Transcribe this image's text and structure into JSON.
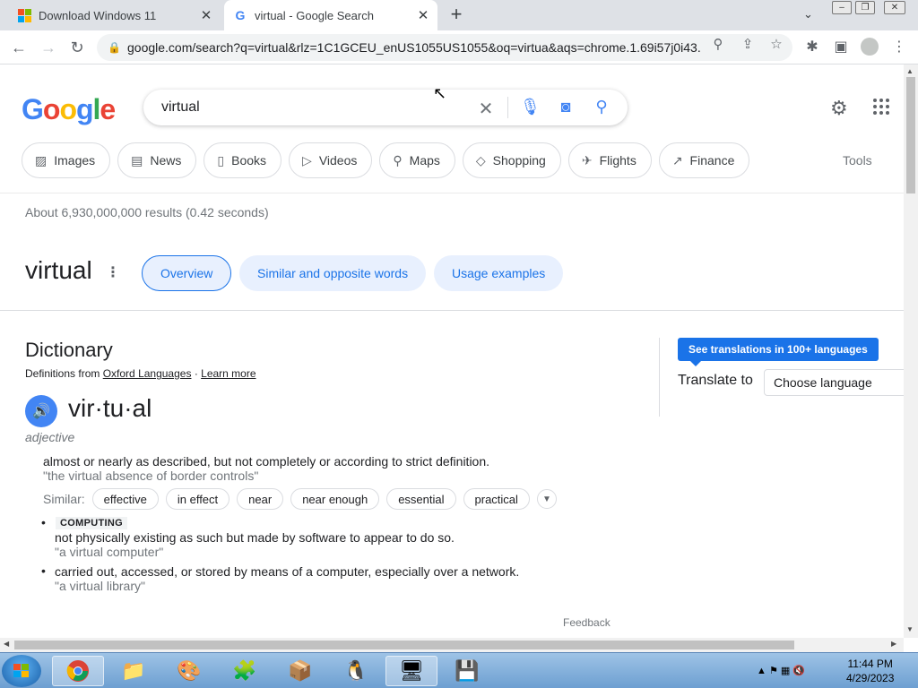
{
  "browser": {
    "tabs": [
      {
        "title": "Download Windows 11",
        "active": false,
        "icon": "windows-logo-icon"
      },
      {
        "title": "virtual - Google Search",
        "active": true,
        "icon": "google-g-icon"
      }
    ],
    "url": "google.com/search?q=virtual&rlz=1C1GCEU_enUS1055US1055&oq=virtua&aqs=chrome.1.69i57j0i43..."
  },
  "search": {
    "query": "virtual",
    "chips": [
      "Images",
      "News",
      "Books",
      "Videos",
      "Maps",
      "Shopping",
      "Flights",
      "Finance"
    ],
    "tools_label": "Tools",
    "stats": "About 6,930,000,000 results (0.42 seconds)"
  },
  "word_header": {
    "word": "virtual",
    "tabs": [
      "Overview",
      "Similar and opposite words",
      "Usage examples"
    ]
  },
  "dictionary": {
    "title": "Dictionary",
    "source_prefix": "Definitions from",
    "source_link": "Oxford Languages",
    "source_sep": "·",
    "learn_more": "Learn more",
    "phonetic": "vir·tu·al",
    "pos": "adjective",
    "def1": "almost or nearly as described, but not completely or according to strict definition.",
    "ex1": "\"the virtual absence of border controls\"",
    "similar_label": "Similar:",
    "similar": [
      "effective",
      "in effect",
      "near",
      "near enough",
      "essential",
      "practical"
    ],
    "tag": "COMPUTING",
    "def2": "not physically existing as such but made by software to appear to do so.",
    "ex2": "\"a virtual computer\"",
    "def3": "carried out, accessed, or stored by means of a computer, especially over a network.",
    "ex3": "\"a virtual library\"",
    "feedback": "Feedback"
  },
  "translate": {
    "button": "See translations in 100+ languages",
    "label": "Translate to",
    "select_value": "Choose language"
  },
  "taskbar": {
    "time": "11:44 PM",
    "date": "4/29/2023"
  },
  "colors": {
    "accent": "#1a73e8",
    "pill_bg": "#e8f0fe"
  }
}
